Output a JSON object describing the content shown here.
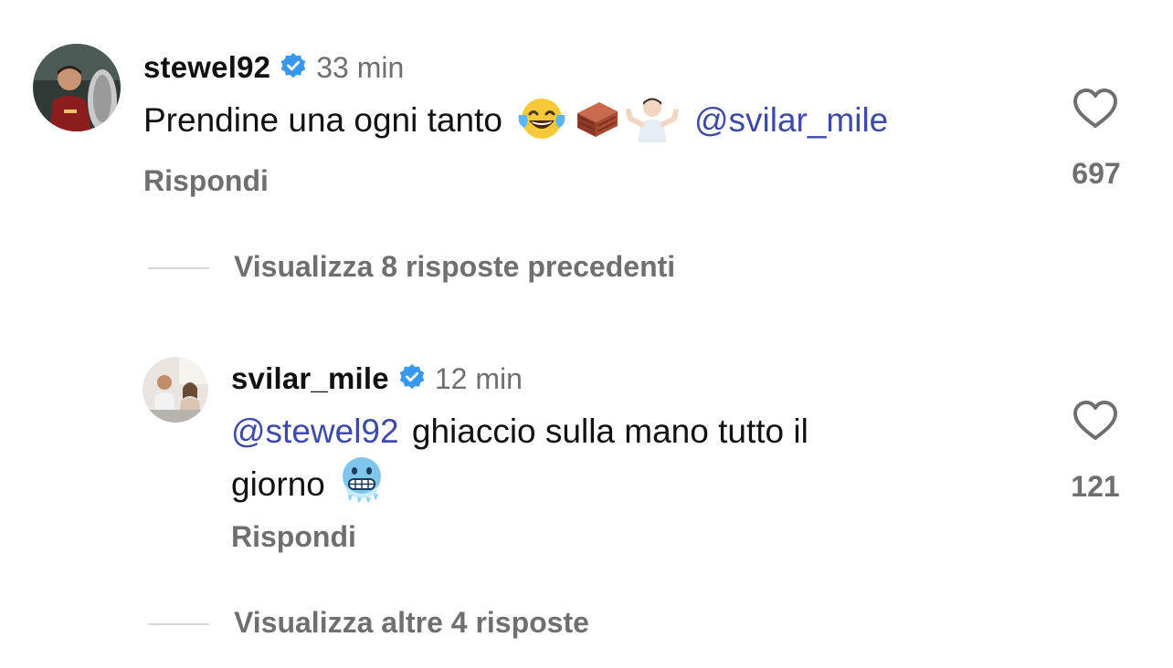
{
  "comment1": {
    "username": "stewel92",
    "time": "33 min",
    "text": "Prendine una ogni tanto",
    "emojis": [
      "laughing-tears-emoji",
      "brick-emoji",
      "shrug-emoji"
    ],
    "mention": "@svilar_mile",
    "reply_label": "Rispondi",
    "likes": "697"
  },
  "view_prev": {
    "label": "Visualizza 8 risposte precedenti"
  },
  "comment2": {
    "username": "svilar_mile",
    "time": "12 min",
    "mention": "@stewel92",
    "text_line1": "ghiaccio sulla mano tutto il",
    "text_line2": "giorno",
    "emojis": [
      "cold-face-emoji"
    ],
    "reply_label": "Rispondi",
    "likes": "121"
  },
  "view_more": {
    "label": "Visualizza altre 4 risposte"
  },
  "colors": {
    "mention": "#3d4aa9",
    "verified": "#3897f0",
    "muted": "#6f6f6f"
  }
}
